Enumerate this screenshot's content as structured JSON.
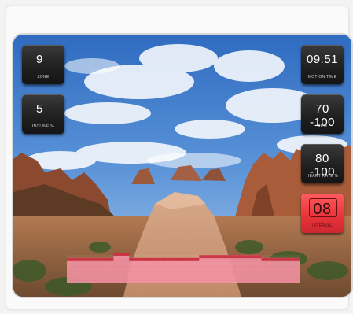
{
  "colors": {
    "accent_red": "#e8323a",
    "tile_dark": "#202020",
    "profile_fill": "#f28ea0",
    "profile_done": "#c93040"
  },
  "metrics_left": [
    {
      "value": "9",
      "label": "ZONE"
    },
    {
      "value": "5",
      "label": "INCLINE %"
    }
  ],
  "metrics_right": [
    {
      "value": "09:51",
      "label": "MOTION TIME"
    },
    {
      "value": "70 -100",
      "label": "RPM"
    },
    {
      "value": "80 -100",
      "label": "HEART RATE %"
    },
    {
      "value": "08",
      "label": "INTERVAL"
    }
  ],
  "workout_profile": {
    "levels": [
      0.78,
      0.78,
      0.78,
      0.78,
      0.78,
      0.78,
      0.95,
      0.95,
      0.78,
      0.78,
      0.78,
      0.78,
      0.78,
      0.78,
      0.78,
      0.78,
      0.78,
      0.87,
      0.87,
      0.87,
      0.87,
      0.87,
      0.87,
      0.87,
      0.87,
      0.78,
      0.78,
      0.78,
      0.78,
      0.78
    ]
  }
}
